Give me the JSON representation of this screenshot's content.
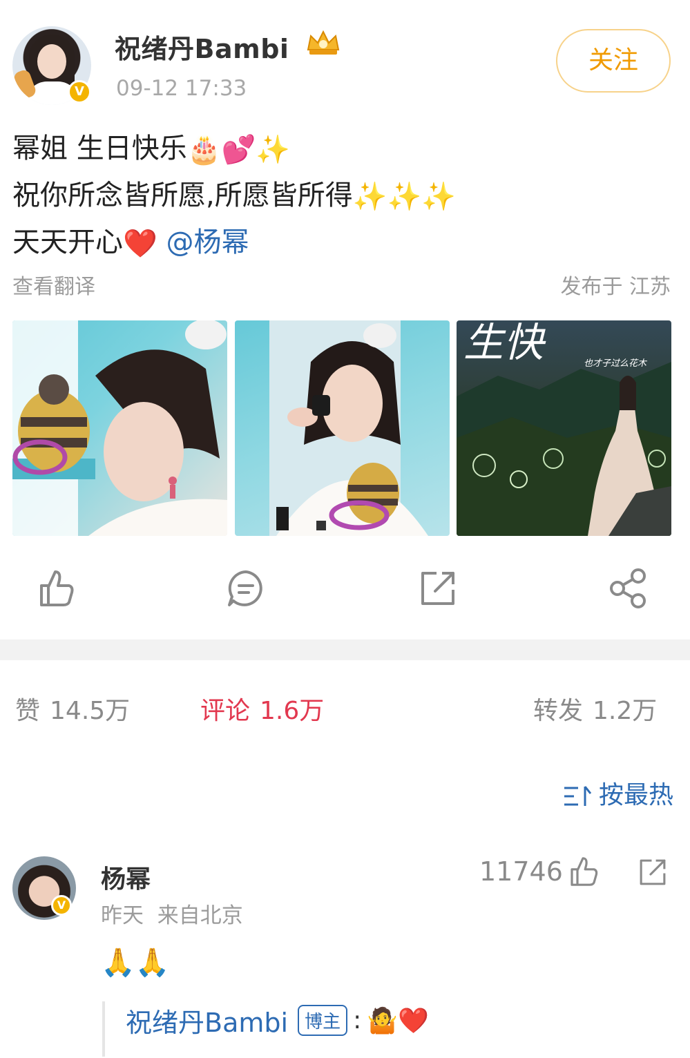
{
  "post": {
    "author": "祝绪丹Bambi",
    "timestamp": "09-12 17:33",
    "follow_label": "关注",
    "lines": [
      {
        "text": "幂姐 生日快乐",
        "emoji": "🎂💕✨"
      },
      {
        "text": "祝你所念皆所愿,所愿皆所得",
        "emoji": "✨✨✨"
      },
      {
        "text": "天天开心",
        "emoji": "❤️",
        "mention": "@杨幂"
      }
    ],
    "translate_label": "查看翻译",
    "location": "发布于 江苏",
    "image_texts": {
      "image3_title": "生快",
      "image3_subtitle": "也才子过么花木"
    }
  },
  "actions": {
    "icons": [
      "thumbs-up-icon",
      "comment-icon",
      "repost-icon",
      "share-icon"
    ]
  },
  "stats": {
    "likes_label": "赞",
    "likes_value": "14.5万",
    "comments_label": "评论",
    "comments_value": "1.6万",
    "reposts_label": "转发",
    "reposts_value": "1.2万"
  },
  "sort": {
    "label": "按最热"
  },
  "comment": {
    "author": "杨幂",
    "time": "昨天",
    "source": "来自北京",
    "likes": "11746",
    "body_emoji": "🙏🙏",
    "reply": {
      "author": "祝绪丹Bambi",
      "tag": "博主",
      "colon": ":",
      "emoji": "🤷❤️"
    }
  },
  "colors": {
    "accent_orange": "#f09a00",
    "link_blue": "#2d6bb3",
    "active_red": "#e2384f"
  }
}
